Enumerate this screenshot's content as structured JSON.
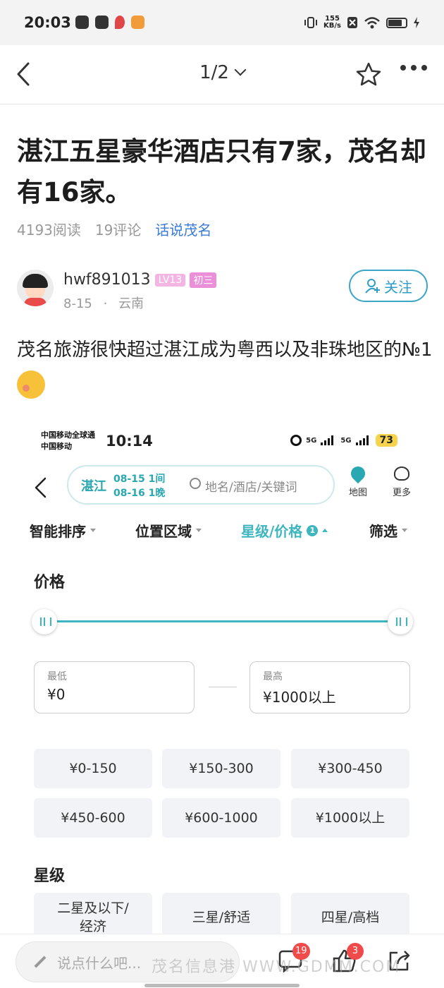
{
  "statusbar": {
    "time": "20:03",
    "net_speed_value": "155",
    "net_speed_unit": "KB/s"
  },
  "navbar": {
    "page_indicator": "1/2"
  },
  "article": {
    "title": "湛江五星豪华酒店只有7家，茂名却有16家。",
    "reads": "4193阅读",
    "comments": "19评论",
    "topic": "话说茂名",
    "author": {
      "name": "hwf891013",
      "level": "LV13",
      "grade": "初三",
      "date": "8-15",
      "location": "云南",
      "follow_label": "关注"
    },
    "body": "茂名旅游很快超过湛江成为粤西以及非珠地区的№1"
  },
  "embedded": {
    "carrier1": "中国移动全球通",
    "carrier2": "中国移动",
    "time": "10:14",
    "net1": "5G",
    "net2": "5G",
    "battery": "73",
    "city": "湛江",
    "checkin": "08-15",
    "checkin_rooms": "1间",
    "checkout": "08-16",
    "checkout_nights": "1晚",
    "search_placeholder": "地名/酒店/关键词",
    "map_label": "地图",
    "more_label": "更多",
    "filters": [
      "智能排序",
      "位置区域",
      "星级/价格",
      "筛选"
    ],
    "filter_count": "1",
    "price_heading": "价格",
    "price_min_fraction": 0,
    "price_max_fraction": 1,
    "min_label": "最低",
    "min_value": "¥0",
    "max_label": "最高",
    "max_value": "¥1000以上",
    "price_chips": [
      "¥0-150",
      "¥150-300",
      "¥300-450",
      "¥450-600",
      "¥600-1000",
      "¥1000以上"
    ],
    "star_heading": "星级",
    "star_chips": [
      "二星及以下/经济",
      "三星/舒适",
      "四星/高档"
    ]
  },
  "bottombar": {
    "comment_placeholder": "说点什么吧...",
    "comment_count": "19",
    "like_count": "3"
  },
  "watermark": "茂名信息港 WWW.GDMM.COM",
  "colors": {
    "accent": "#3db6c0",
    "link": "#3a7bd5",
    "badge_red": "#f04b4b"
  }
}
